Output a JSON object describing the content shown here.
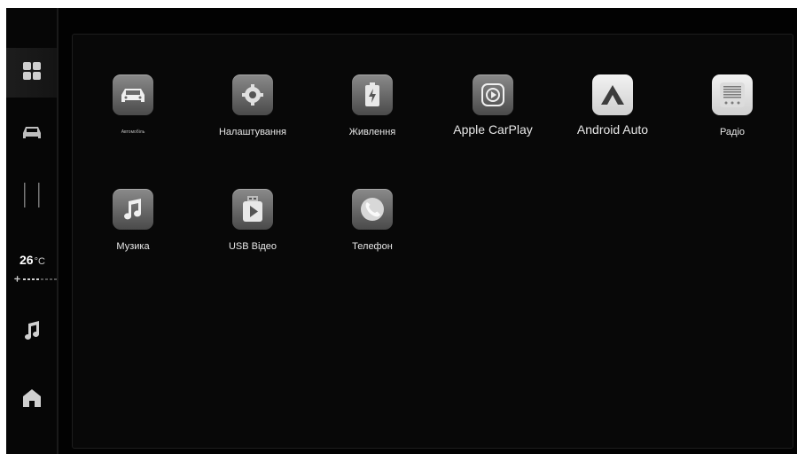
{
  "sidebar": {
    "items": [
      {
        "name": "apps-grid",
        "icon": "grid-icon",
        "active": true
      },
      {
        "name": "vehicle",
        "icon": "car-icon",
        "active": false
      },
      {
        "name": "split-view",
        "icon": "split-icon",
        "active": false
      },
      {
        "name": "music",
        "icon": "music-note-icon",
        "active": false
      },
      {
        "name": "home",
        "icon": "home-icon",
        "active": false
      }
    ],
    "climate": {
      "temperature": "26",
      "unit": "°C",
      "fan_level_fraction": 0.5
    }
  },
  "apps": [
    {
      "label": "Автомобіль",
      "icon": "car-icon"
    },
    {
      "label": "Налаштування",
      "icon": "gear-icon"
    },
    {
      "label": "Живлення",
      "icon": "battery-icon"
    },
    {
      "label": "Apple CarPlay",
      "icon": "carplay-icon"
    },
    {
      "label": "Android Auto",
      "icon": "android-auto-icon"
    },
    {
      "label": "Радіо",
      "icon": "radio-icon"
    },
    {
      "label": "Музика",
      "icon": "music-note-icon"
    },
    {
      "label": "USB Відео",
      "icon": "usb-video-icon"
    },
    {
      "label": "Телефон",
      "icon": "phone-icon"
    }
  ],
  "colors": {
    "background": "#020202",
    "panel": "#080808",
    "icon_gradient_top": "#8a8a8a",
    "icon_gradient_bottom": "#4a4a4a",
    "text": "#e8e8e8"
  }
}
